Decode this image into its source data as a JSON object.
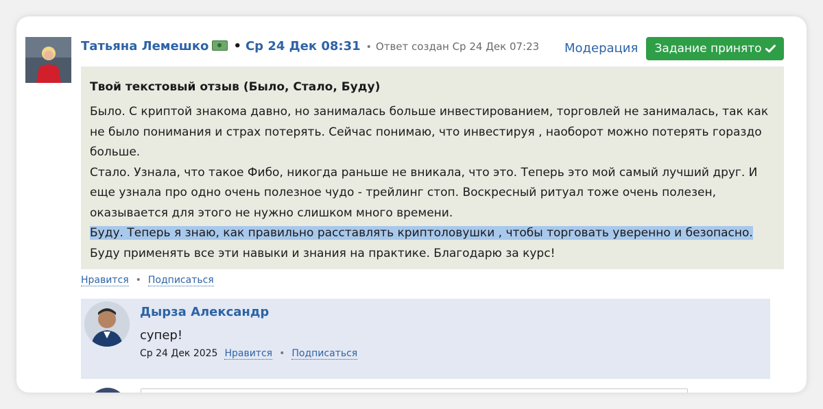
{
  "post": {
    "author": "Татьяна Лемешко",
    "author_badge_icon": "money-bill-icon",
    "date": "Ср 24 Дек 08:31",
    "separator_strong": "•",
    "separator_small": "•",
    "created_note": "Ответ создан Ср 24 Дек 07:23",
    "moderation_label": "Модерация",
    "accept_label": "Задание принято",
    "accept_color": "#2e9e47",
    "body_title": "Твой текстовый отзыв (Было, Стало, Буду)",
    "paragraphs": [
      "Было. С криптой знакома давно, но занималась больше инвестированием, торговлей не занималась, так как не было понимания и страх потерять. Сейчас понимаю, что инвестируя , наоборот можно потерять гораздо больше.",
      "Стало. Узнала, что такое Фибо, никогда раньше не вникала, что это. Теперь это мой самый лучший друг. И еще узнала про одно очень полезное чудо - трейлинг стоп. Воскресный ритуал тоже очень полезен, оказывается для этого не нужно слишком много времени."
    ],
    "highlighted_text": "Буду. Теперь я знаю, как правильно расставлять криптоловушки , чтобы торговать уверенно и безопасно.",
    "after_highlight_text": " Буду применять все эти навыки и знания на практике. Благодарю за курс!",
    "like_label": "Нравится",
    "actions_separator": "•",
    "subscribe_label": "Подписаться"
  },
  "reply": {
    "author": "Дырза Александр",
    "text": "супер!",
    "date": "Ср 24 Дек 2025",
    "like_label": "Нравится",
    "actions_separator": "•",
    "subscribe_label": "Подписаться"
  },
  "new_comment": {
    "value": ""
  }
}
